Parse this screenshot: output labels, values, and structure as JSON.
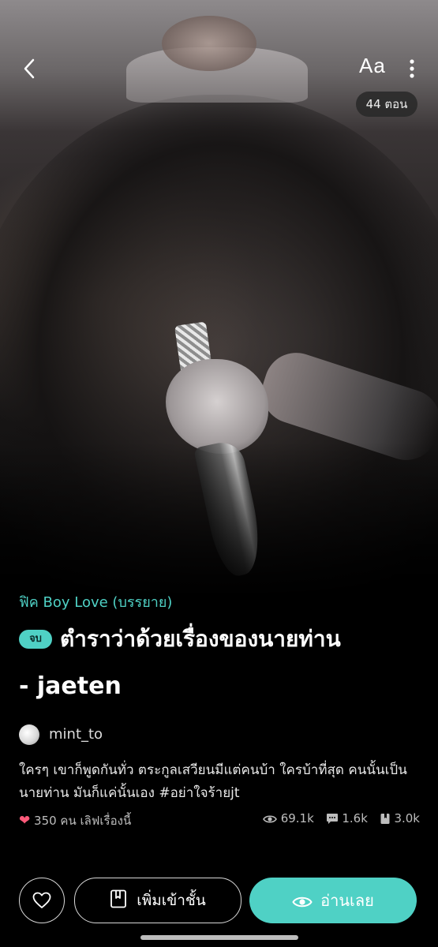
{
  "header": {
    "font_size_label": "Aa",
    "episodes_badge": "44 ตอน"
  },
  "story": {
    "genre": "ฟิค Boy Love (บรรยาย)",
    "status_badge": "จบ",
    "title_line1": "ตำราว่าด้วยเรื่องของนายท่าน",
    "title_line2": "- jaeten",
    "author": "mint_to",
    "description": "ใครๆ เขาก็พูดกันทั่ว ตระกูลเสวียนมีแต่คนบ้า ใครบ้าที่สุด คนนั้นเป็นนายท่าน มันก็แค่นั้นเอง #อย่าใจร้ายjt"
  },
  "stats": {
    "likes": "350 คน เลิฟเรื่องนี้",
    "views": "69.1k",
    "comments": "1.6k",
    "saves": "3.0k"
  },
  "actions": {
    "add_to_shelf": "เพิ่มเข้าชั้น",
    "read_now": "อ่านเลย"
  },
  "colors": {
    "accent": "#4fd1c5",
    "heart": "#ff5a7a"
  },
  "icons": [
    "back-chevron-icon",
    "font-size-icon",
    "more-vertical-icon",
    "heart-icon",
    "eye-icon",
    "comment-icon",
    "bookmark-icon",
    "book-icon"
  ]
}
